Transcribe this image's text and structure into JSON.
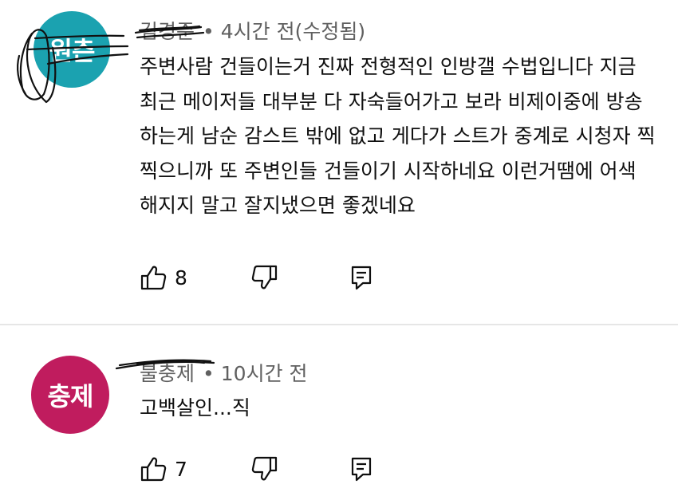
{
  "comments": [
    {
      "avatar": {
        "text": "원츤",
        "color": "#1ba2b0"
      },
      "author": "김경준",
      "time": "4시간 전(수정됨)",
      "lines": [
        "주변사람 건들이는거 진짜 전형적인 인방갤 수법입니다 지금",
        "최근 메이저들 대부분 다 자숙들어가고 보라 비제이중에 방송",
        "하는게 남순 감스트 밖에 없고 게다가 스트가 중계로 시청자 찍",
        "찍으니까 또 주변인들 건들이기 시작하네요 이런거땜에 어색",
        "해지지 말고 잘지냈으면 좋겠네요"
      ],
      "likes": "8"
    },
    {
      "avatar": {
        "text": "충제",
        "color": "#c01c5e"
      },
      "author": "불충제",
      "time": "10시간 전",
      "lines": [
        "고백살인...직"
      ],
      "likes": "7"
    }
  ],
  "icons": {
    "like": "thumb-up-icon",
    "dislike": "thumb-down-icon",
    "reply": "reply-comment-icon"
  },
  "colors": {
    "text": "#0f0f0f",
    "meta": "#606060",
    "divider": "#e6e6e6",
    "scribble": "#111111"
  }
}
